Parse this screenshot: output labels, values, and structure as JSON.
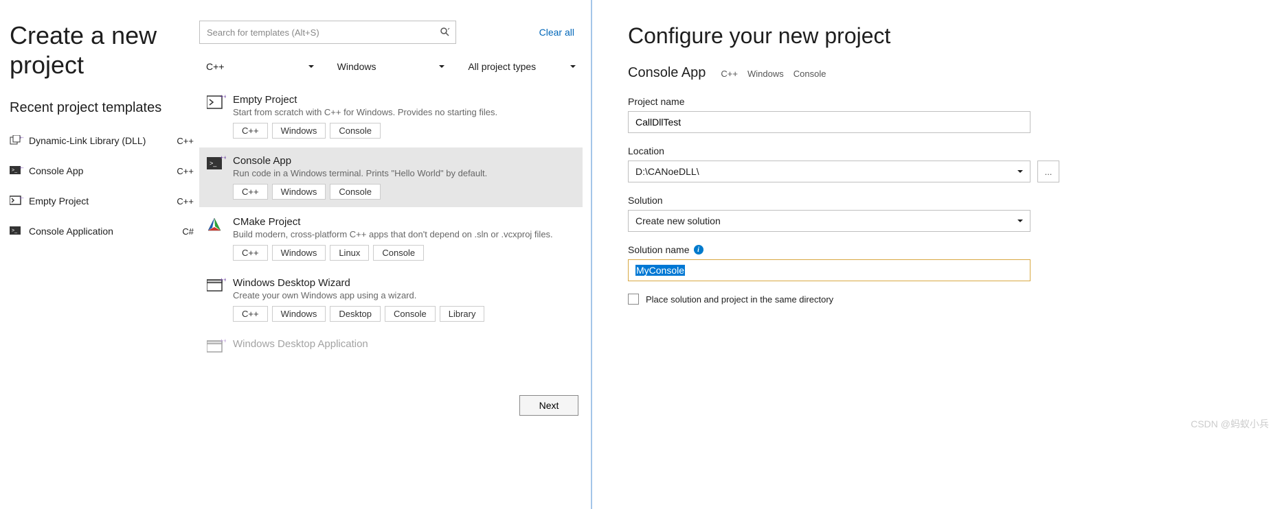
{
  "left": {
    "title": "Create a new project",
    "recent_heading": "Recent project templates",
    "recent": [
      {
        "label": "Dynamic-Link Library (DLL)",
        "lang": "C++"
      },
      {
        "label": "Console App",
        "lang": "C++"
      },
      {
        "label": "Empty Project",
        "lang": "C++"
      },
      {
        "label": "Console Application",
        "lang": "C#"
      }
    ],
    "search_placeholder": "Search for templates (Alt+S)",
    "clear_all": "Clear all",
    "filters": {
      "language": "C++",
      "platform": "Windows",
      "type": "All project types"
    },
    "templates": [
      {
        "title": "Empty Project",
        "desc": "Start from scratch with C++ for Windows. Provides no starting files.",
        "tags": [
          "C++",
          "Windows",
          "Console"
        ],
        "selected": false
      },
      {
        "title": "Console App",
        "desc": "Run code in a Windows terminal. Prints \"Hello World\" by default.",
        "tags": [
          "C++",
          "Windows",
          "Console"
        ],
        "selected": true
      },
      {
        "title": "CMake Project",
        "desc": "Build modern, cross-platform C++ apps that don't depend on .sln or .vcxproj files.",
        "tags": [
          "C++",
          "Windows",
          "Linux",
          "Console"
        ],
        "selected": false
      },
      {
        "title": "Windows Desktop Wizard",
        "desc": "Create your own Windows app using a wizard.",
        "tags": [
          "C++",
          "Windows",
          "Desktop",
          "Console",
          "Library"
        ],
        "selected": false
      },
      {
        "title": "Windows Desktop Application",
        "desc": "",
        "tags": [],
        "selected": false
      }
    ],
    "next_button": "Next"
  },
  "right": {
    "title": "Configure your new project",
    "template_name": "Console App",
    "template_tags": [
      "C++",
      "Windows",
      "Console"
    ],
    "project_name_label": "Project name",
    "project_name": "CallDllTest",
    "location_label": "Location",
    "location": "D:\\CANoeDLL\\",
    "browse_btn": "...",
    "solution_label": "Solution",
    "solution": "Create new solution",
    "solution_name_label": "Solution name",
    "solution_name": "MyConsole",
    "same_dir_label": "Place solution and project in the same directory"
  },
  "watermark": "CSDN @蚂蚁小兵"
}
